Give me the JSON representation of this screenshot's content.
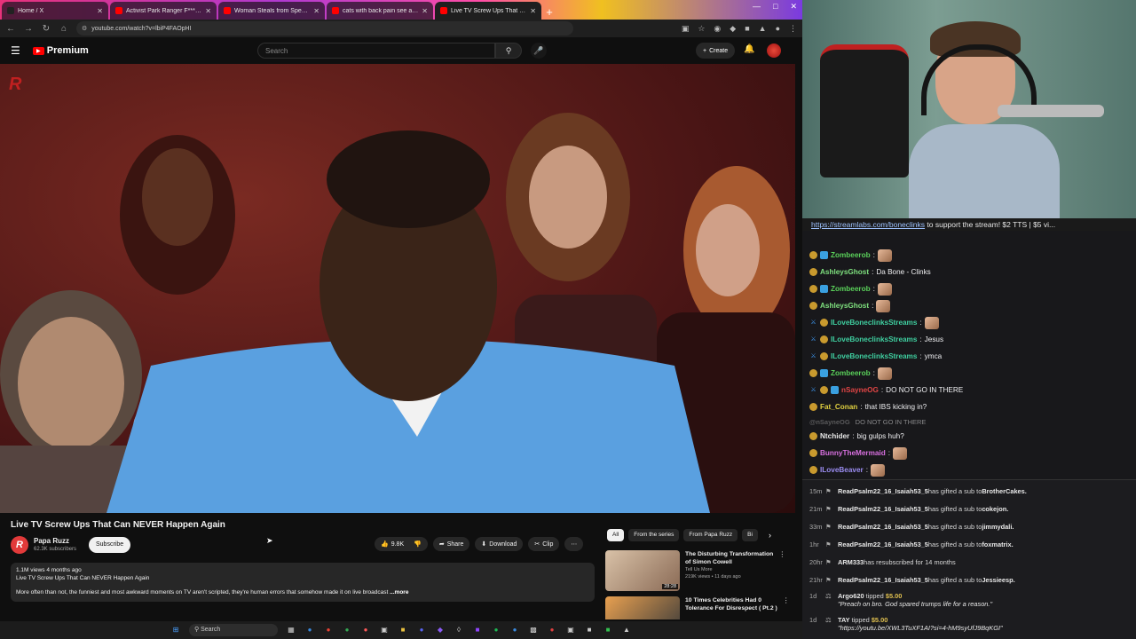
{
  "browser": {
    "tabs": [
      {
        "title": "Home / X",
        "color": "#222222",
        "active": false
      },
      {
        "title": "Activist Park Ranger F***'s Arou",
        "color": "#ff0000",
        "active": false
      },
      {
        "title": "Woman Steals from Special Ne",
        "color": "#ff0000",
        "active": false
      },
      {
        "title": "cats with back pain see a chiro",
        "color": "#ff0000",
        "active": false
      },
      {
        "title": "Live TV Screw Ups That Can",
        "color": "#ff0000",
        "active": true
      }
    ],
    "url": "youtube.com/watch?v=lbiP4FAOpHI"
  },
  "youtube": {
    "brand": "Premium",
    "search_placeholder": "Search",
    "create_label": "Create",
    "watermark": "R",
    "video_title": "Live TV Screw Ups That Can NEVER Happen Again",
    "channel": {
      "name": "Papa Ruzz",
      "subs": "62.3K subscribers",
      "avatar_letter": "R"
    },
    "subscribe_label": "Subscribe",
    "actions": {
      "likes": "9.8K",
      "share": "Share",
      "download": "Download",
      "clip": "Clip",
      "more": "⋯"
    },
    "description": {
      "meta": "1.1M views  4 months ago",
      "line1": "Live TV Screw Ups That Can NEVER Happen Again",
      "line2": "More often than not, the funniest and most awkward moments on TV aren't scripted, they're human errors that somehow made it on live broadcast",
      "more": "...more"
    },
    "chips": [
      "All",
      "From the series",
      "From Papa Ruzz",
      "Bi"
    ],
    "recommendations": [
      {
        "title1": "The Disturbing Transformation",
        "title2": "of Simon Cowell",
        "channel": "Tell Us More",
        "stats": "219K views • 11 days ago",
        "duration": "28:28"
      },
      {
        "title1": "10 Times Celebrities Had 0",
        "title2": "Tolerance For Disrespect ( Pt.2 )",
        "channel": "",
        "stats": "",
        "duration": ""
      }
    ]
  },
  "taskbar": {
    "search_label": "Search"
  },
  "stream": {
    "ticker_link": "https://streamlabs.com/boneclinks",
    "ticker_text": " to support the stream! $2 TTS | $5 vi..."
  },
  "chat": [
    {
      "user": "Zombeerob",
      "color": "#5ad15a",
      "text": "",
      "emote": true,
      "badges": [
        "sub",
        "prime"
      ]
    },
    {
      "user": "AshleysGhost",
      "color": "#7ee07e",
      "text": "Da Bone - Clinks",
      "emote": false,
      "badges": [
        "sub"
      ]
    },
    {
      "user": "Zombeerob",
      "color": "#5ad15a",
      "text": "",
      "emote": true,
      "badges": [
        "sub",
        "prime"
      ]
    },
    {
      "user": "AshleysGhost",
      "color": "#7ee07e",
      "text": "",
      "emote": true,
      "badges": [
        "sub"
      ]
    },
    {
      "user": "ILoveBoneclinksStreams",
      "color": "#3fcfa0",
      "text": "",
      "emote": true,
      "badges": [
        "sword",
        "sub"
      ]
    },
    {
      "user": "ILoveBoneclinksStreams",
      "color": "#3fcfa0",
      "text": "Jesus",
      "emote": false,
      "badges": [
        "sword",
        "sub"
      ]
    },
    {
      "user": "ILoveBoneclinksStreams",
      "color": "#3fcfa0",
      "text": "ymca",
      "emote": false,
      "badges": [
        "sword",
        "sub"
      ]
    },
    {
      "user": "Zombeerob",
      "color": "#5ad15a",
      "text": "",
      "emote": true,
      "badges": [
        "sub",
        "prime"
      ]
    },
    {
      "user": "nSayneOG",
      "color": "#e04545",
      "text": "DO NOT GO IN THERE",
      "emote": false,
      "badges": [
        "sword",
        "sub",
        "prime"
      ]
    },
    {
      "user": "Fat_Conan",
      "color": "#e0d040",
      "text": "that IBS kicking in?",
      "emote": false,
      "badges": [
        "sub"
      ]
    },
    {
      "user": "@nSayneOG",
      "color": "#9a9a9a",
      "text": "DO NOT GO IN THERE",
      "emote": false,
      "badges": [],
      "faded": true
    },
    {
      "user": "Ntchider",
      "color": "#e8e8e8",
      "text": "big gulps huh?",
      "emote": false,
      "badges": [
        "sub"
      ]
    },
    {
      "user": "BunnyTheMermaid",
      "color": "#d870e0",
      "text": "",
      "emote": true,
      "badges": [
        "sub"
      ]
    },
    {
      "user": "ILoveBeaver",
      "color": "#9a8cf0",
      "text": "",
      "emote": true,
      "badges": [
        "sub"
      ]
    }
  ],
  "events": [
    {
      "time": "15m",
      "user": "ReadPsalm22_16_Isaiah53_5",
      "text": " has gifted a sub to ",
      "target": "BrotherCakes."
    },
    {
      "time": "21m",
      "user": "ReadPsalm22_16_Isaiah53_5",
      "text": " has gifted a sub to ",
      "target": "cokejon."
    },
    {
      "time": "33m",
      "user": "ReadPsalm22_16_Isaiah53_5",
      "text": " has gifted a sub to ",
      "target": "jimmydali."
    },
    {
      "time": "1hr",
      "user": "ReadPsalm22_16_Isaiah53_5",
      "text": " has gifted a sub to ",
      "target": "foxmatrix."
    },
    {
      "time": "20hr",
      "user": "ARM333",
      "text": " has resubscribed for 14 months",
      "target": ""
    },
    {
      "time": "21hr",
      "user": "ReadPsalm22_16_Isaiah53_5",
      "text": " has gifted a sub to ",
      "target": "Jessieesp."
    }
  ],
  "tips": [
    {
      "time": "1d",
      "user": "Argo620",
      "amount": "$5.00",
      "message": "\"Preach on bro. God spared trumps life for a reason.\""
    },
    {
      "time": "1d",
      "user": "TAY",
      "amount": "$5.00",
      "message": "\"https://youtu.be/XWL3TuXF1AI?si=4-hM9syUfJ9BqKGI\""
    }
  ]
}
